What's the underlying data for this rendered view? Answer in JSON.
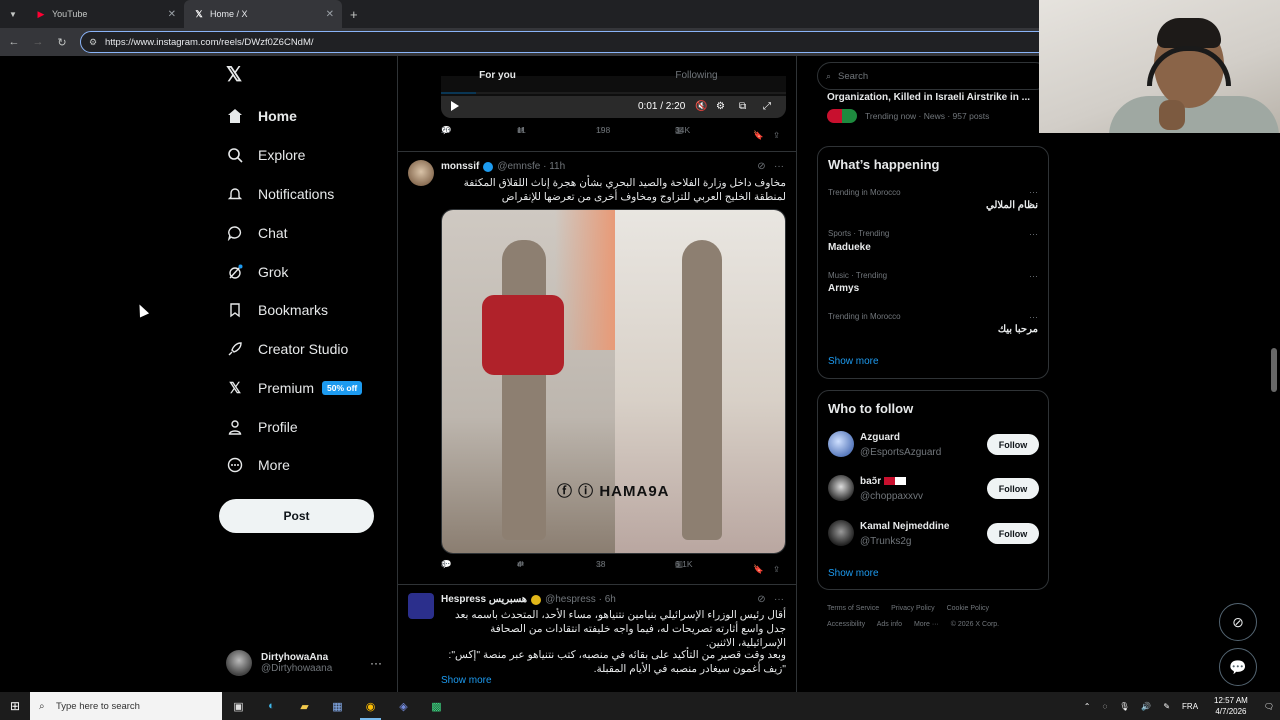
{
  "browser": {
    "tabs": [
      {
        "title": "YouTube",
        "active": false
      },
      {
        "title": "Home / X",
        "active": true
      }
    ],
    "url": "https://www.instagram.com/reels/DWzf0Z6CNdM/"
  },
  "nav": {
    "items": [
      {
        "label": "Home",
        "icon": "home-icon"
      },
      {
        "label": "Explore",
        "icon": "search-icon"
      },
      {
        "label": "Notifications",
        "icon": "bell-icon"
      },
      {
        "label": "Chat",
        "icon": "chat-bubble-icon"
      },
      {
        "label": "Grok",
        "icon": "grok-icon"
      },
      {
        "label": "Bookmarks",
        "icon": "bookmark-icon"
      },
      {
        "label": "Creator Studio",
        "icon": "rocket-icon"
      },
      {
        "label": "Premium",
        "icon": "x-logo-icon",
        "badge": "50% off"
      },
      {
        "label": "Profile",
        "icon": "person-icon"
      },
      {
        "label": "More",
        "icon": "more-circle-icon"
      }
    ],
    "post_label": "Post",
    "account": {
      "name": "DirtyhowaAna",
      "handle": "@Dirtyhowaana"
    }
  },
  "feed": {
    "tabs": [
      "For you",
      "Following"
    ],
    "video": {
      "time": "0:01 / 2:20",
      "progress": 0.1
    },
    "first_actions": {
      "replies": "20",
      "reposts": "11",
      "likes": "198",
      "views": "34K"
    },
    "tweets": [
      {
        "name": "monssif",
        "handle": "@emnsfe",
        "time": "11h",
        "text": "مخاوف داخل وزارة الفلاحة والصيد البحري بشأن هجرة إناث اللقلاق المكثفة لمنطقة الخليج العربي للتزاوج ومخاوف أخرى من تعرضها للإنقراض",
        "media_watermark": "HAMA9A",
        "actions": {
          "replies": "8",
          "reposts": "4",
          "likes": "38",
          "views": "6.1K"
        }
      },
      {
        "name": "Hespress هسبريس",
        "handle": "@hespress",
        "time": "6h",
        "text": "أقال رئيس الوزراء الإسرائيلي بنيامين نتنياهو، مساء الأحد، المتحدث باسمه بعد جدل واسع أثارته تصريحات له، فيما واجه خليفته انتقادات من الصحافة الإسرائيلية، الاثنين.",
        "text2": "وبعد وقت قصير من التأكيد على بقائه في منصبه، كتب نتنياهو عبر منصة \"إكس\": \"زيف أغمون سيغادر منصبه في الأيام المقبلة.",
        "show_more": "Show more"
      }
    ]
  },
  "sidebar": {
    "search_placeholder": "Search",
    "top_trend": {
      "title": "Organization, Killed in Israeli Airstrike in ...",
      "meta": "Trending now · News · 957 posts"
    },
    "happening": {
      "title": "What’s happening",
      "trends": [
        {
          "meta": "Trending in Morocco",
          "name": "نظام الملالي"
        },
        {
          "meta": "Sports · Trending",
          "name": "Madueke"
        },
        {
          "meta": "Music · Trending",
          "name": "Armys"
        },
        {
          "meta": "Trending in Morocco",
          "name": "مرحبا بيك"
        }
      ],
      "show_more": "Show more"
    },
    "who_to_follow": {
      "title": "Who to follow",
      "accounts": [
        {
          "name": "Azguard",
          "handle": "@EsportsAzguard"
        },
        {
          "name": "baɔ̃r",
          "handle": "@choppaxxvv"
        },
        {
          "name": "Kamal Nejmeddine",
          "handle": "@Trunks2g"
        }
      ],
      "follow_label": "Follow",
      "show_more": "Show more"
    },
    "footer": [
      "Terms of Service",
      "Privacy Policy",
      "Cookie Policy",
      "Accessibility",
      "Ads info",
      "More ···",
      "© 2026 X Corp."
    ]
  },
  "taskbar": {
    "search_placeholder": "Type here to search",
    "lang": "FRA",
    "time": "12:57 AM",
    "date": "4/7/2026"
  },
  "colors": {
    "accent": "#1d9bf0",
    "background": "#000000",
    "border": "#2f3336",
    "muted": "#71767b"
  }
}
